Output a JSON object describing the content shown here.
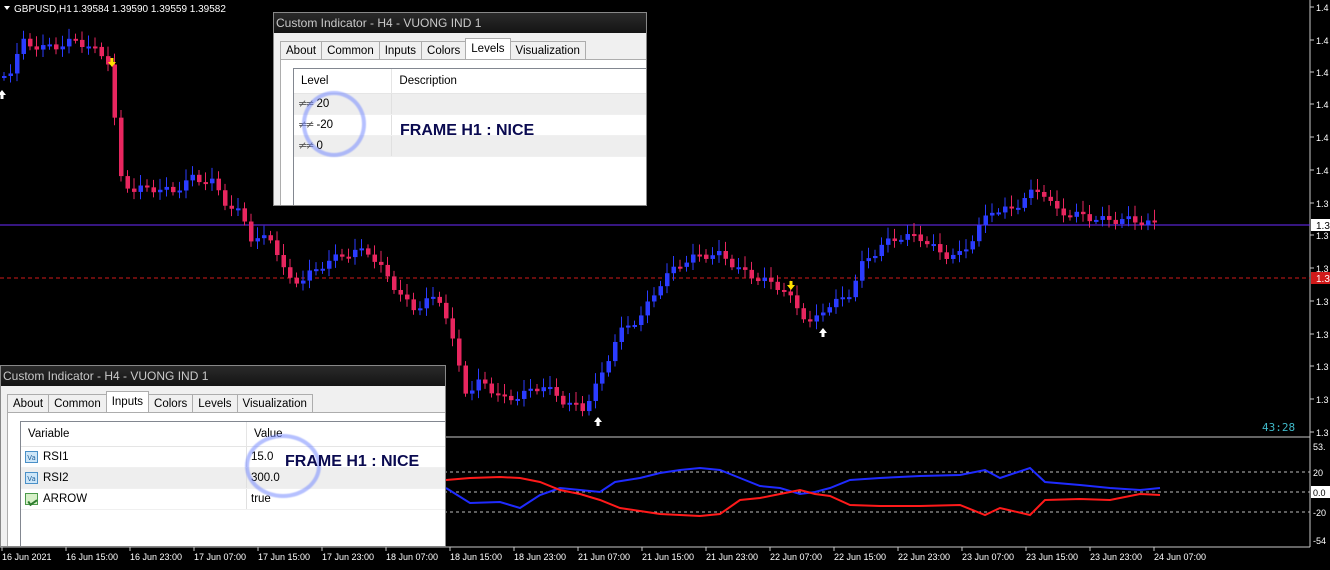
{
  "chart_header": {
    "symbol": "GBPUSD,H1",
    "quote": "1.39584 1.39590 1.39559 1.39582"
  },
  "timer": "43:28",
  "price_axis": {
    "labels": [
      "1.4",
      "1.4",
      "1.4",
      "1.4",
      "1.4",
      "1.4",
      "1.3",
      "1.3",
      "1.3",
      "1.3",
      "1.3",
      "1.3",
      "1.3",
      "1.3",
      "1.3",
      "1.3"
    ],
    "current_label": "1.3",
    "marker_label": "1.3"
  },
  "indicator_axis": {
    "labels": [
      "53.",
      "20",
      "0.0",
      "-20",
      "-54"
    ]
  },
  "time_axis": [
    "16 Jun 2021",
    "16 Jun 15:00",
    "16 Jun 23:00",
    "17 Jun 07:00",
    "17 Jun 15:00",
    "17 Jun 23:00",
    "18 Jun 07:00",
    "18 Jun 15:00",
    "18 Jun 23:00",
    "21 Jun 07:00",
    "21 Jun 15:00",
    "21 Jun 23:00",
    "22 Jun 07:00",
    "22 Jun 15:00",
    "22 Jun 23:00",
    "23 Jun 07:00",
    "23 Jun 15:00",
    "23 Jun 23:00",
    "24 Jun 07:00"
  ],
  "colors": {
    "bull": "#2b3cff",
    "bear": "#e8265f",
    "rsi_fast": "#1f2bff",
    "rsi_slow": "#ff1a1a",
    "hline": "#6b2cff",
    "dashed": "#d01a1a"
  },
  "dialog_levels": {
    "title": "Custom Indicator - H4 - VUONG IND 1",
    "tabs": [
      "About",
      "Common",
      "Inputs",
      "Colors",
      "Levels",
      "Visualization"
    ],
    "active_tab": "Levels",
    "columns": [
      "Level",
      "Description"
    ],
    "rows": [
      {
        "level": "20",
        "description": ""
      },
      {
        "level": "-20",
        "description": ""
      },
      {
        "level": "0",
        "description": ""
      }
    ],
    "annotation": "FRAME H1 : NICE"
  },
  "dialog_inputs": {
    "title": "Custom Indicator - H4 - VUONG IND 1",
    "tabs": [
      "About",
      "Common",
      "Inputs",
      "Colors",
      "Levels",
      "Visualization"
    ],
    "active_tab": "Inputs",
    "columns": [
      "Variable",
      "Value"
    ],
    "rows": [
      {
        "variable": "RSI1",
        "value": "15.0",
        "icon": "variable-icon"
      },
      {
        "variable": "RSI2",
        "value": "300.0",
        "icon": "variable-icon"
      },
      {
        "variable": "ARROW",
        "value": "true",
        "icon": "bool-icon"
      }
    ],
    "annotation": "FRAME H1 : NICE"
  }
}
